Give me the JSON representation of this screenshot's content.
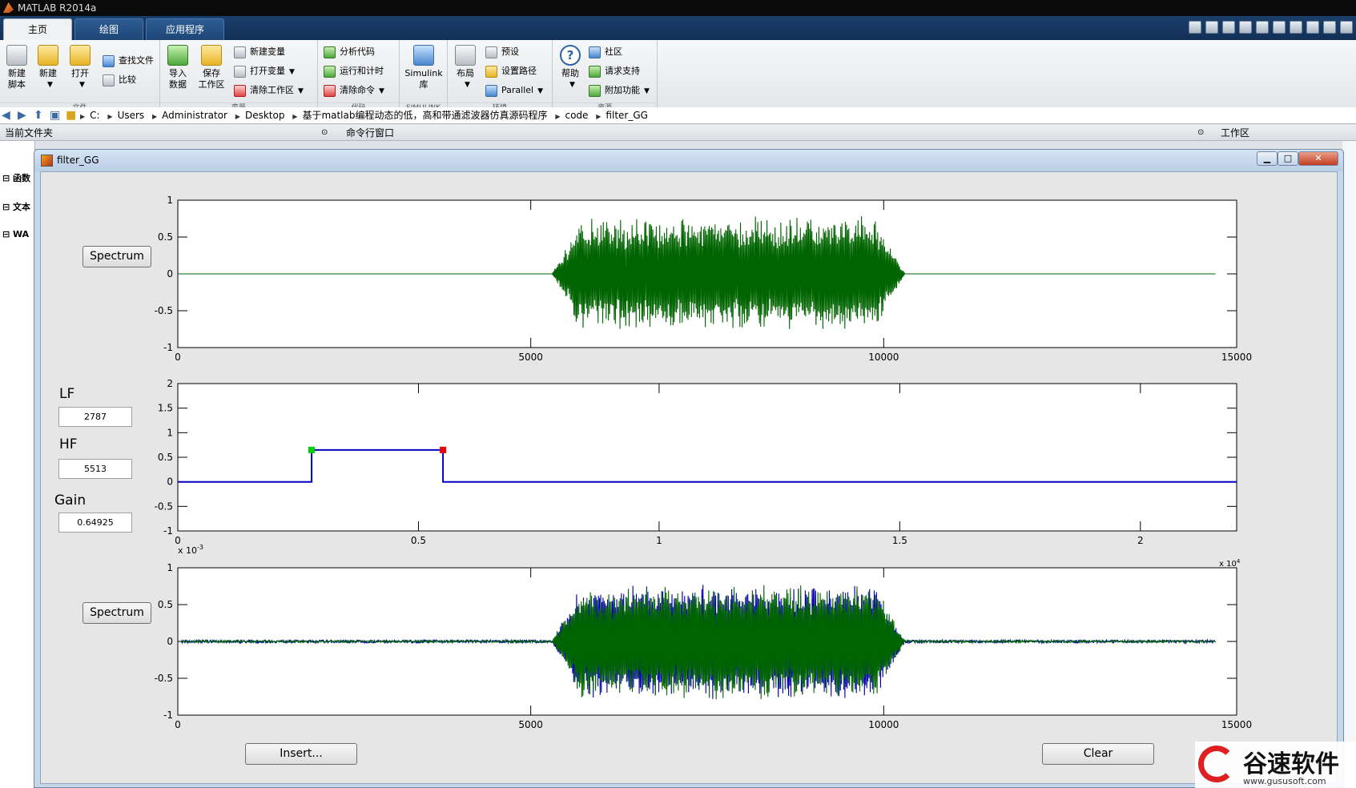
{
  "window": {
    "title": "MATLAB R2014a"
  },
  "tabs": [
    "主页",
    "绘图",
    "应用程序"
  ],
  "ribbon": {
    "file": {
      "label": "文件",
      "new_script": "新建\n脚本",
      "new": "新建",
      "open": "打开",
      "find_files": "查找文件",
      "compare": "比较"
    },
    "variable": {
      "label": "变量",
      "import": "导入\n数据",
      "save_ws": "保存\n工作区",
      "new_var": "新建变量",
      "open_var": "打开变量",
      "clear_ws": "清除工作区"
    },
    "code": {
      "label": "代码",
      "analyze": "分析代码",
      "run_time": "运行和计时",
      "clear_cmd": "清除命令"
    },
    "simulink": {
      "label": "SIMULINK",
      "lib": "Simulink\n库"
    },
    "env": {
      "label": "环境",
      "layout": "布局",
      "prefs": "预设",
      "set_path": "设置路径",
      "parallel": "Parallel"
    },
    "res": {
      "label": "资源",
      "help": "帮助",
      "community": "社区",
      "support": "请求支持",
      "addons": "附加功能"
    }
  },
  "address": {
    "crumbs": [
      "C:",
      "Users",
      "Administrator",
      "Desktop",
      "基于matlab编程动态的低，高和带通滤波器仿真源码程序",
      "code",
      "filter_GG"
    ]
  },
  "panels": {
    "current_folder": "当前文件夹",
    "command_window": "命令行窗口",
    "workspace": "工作区"
  },
  "left_items": [
    "函数",
    "文本",
    "WA"
  ],
  "figure": {
    "title": "filter_GG",
    "spectrum_label": "Spectrum",
    "insert_label": "Insert...",
    "clear_label": "Clear",
    "lf_label": "LF",
    "lf_value": "2787",
    "hf_label": "HF",
    "hf_value": "5513",
    "gain_label": "Gain",
    "gain_value": "0.64925"
  },
  "watermark": {
    "text": "谷速软件",
    "url": "www.gususoft.com"
  },
  "chart_data": [
    {
      "type": "line",
      "name_hint": "input signal",
      "xlim": [
        0,
        15000
      ],
      "ylim": [
        -1,
        1
      ],
      "xticks": [
        0,
        5000,
        10000,
        15000
      ],
      "yticks": [
        -1,
        -0.5,
        0,
        0.5,
        1
      ],
      "series": [
        {
          "color": "#006400",
          "burst": {
            "start": 5300,
            "end": 10300,
            "amplitude": 0.72
          },
          "extent": [
            0,
            14700
          ]
        }
      ]
    },
    {
      "type": "line",
      "name_hint": "filter response",
      "xlim": [
        0,
        0.0022
      ],
      "ylim": [
        -1,
        2
      ],
      "xticks": [
        0,
        0.5,
        1,
        1.5,
        2
      ],
      "yticks": [
        -1,
        -0.5,
        0,
        0.5,
        1,
        1.5,
        2
      ],
      "xexponent": "x 10^-3",
      "series": [
        {
          "color": "#0000c0",
          "points": [
            [
              0,
              0
            ],
            [
              0.000278,
              0
            ],
            [
              0.000278,
              0.649
            ],
            [
              0.000551,
              0.649
            ],
            [
              0.000551,
              0
            ],
            [
              0.0022,
              0
            ]
          ]
        }
      ],
      "markers": [
        {
          "x": 0.000278,
          "y": 0.649,
          "color": "#00cc00"
        },
        {
          "x": 0.000551,
          "y": 0.649,
          "color": "#ee0000"
        }
      ]
    },
    {
      "type": "line",
      "name_hint": "output signal",
      "xlim": [
        0,
        15000
      ],
      "ylim": [
        -1,
        1
      ],
      "xticks": [
        0,
        5000,
        10000,
        15000
      ],
      "yticks": [
        -1,
        -0.5,
        0,
        0.5,
        1
      ],
      "xexponent_right": "x 10^4",
      "series": [
        {
          "color": "#0000aa",
          "burst": {
            "start": 5300,
            "end": 10300,
            "amplitude": 0.72
          },
          "extent": [
            50,
            14700
          ],
          "noise": 0.02
        },
        {
          "color": "#006400",
          "burst": {
            "start": 5300,
            "end": 10300,
            "amplitude": 0.72
          },
          "extent": [
            50,
            14700
          ],
          "noise": 0.015
        }
      ]
    }
  ]
}
